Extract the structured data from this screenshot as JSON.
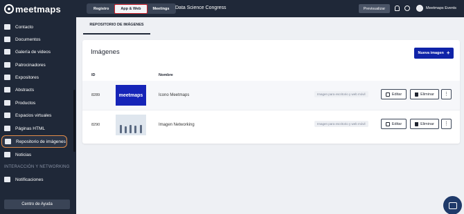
{
  "app": {
    "logo": "meetmaps"
  },
  "sidebar": {
    "items": [
      {
        "label": "Contacto",
        "icon": "contact-icon"
      },
      {
        "label": "Documentos",
        "icon": "document-icon"
      },
      {
        "label": "Galería de videos",
        "icon": "video-icon"
      },
      {
        "label": "Patrocinadores",
        "icon": "sponsors-icon"
      },
      {
        "label": "Expositores",
        "icon": "exhibitors-icon"
      },
      {
        "label": "Abstracts",
        "icon": "abstracts-icon"
      },
      {
        "label": "Productos",
        "icon": "products-icon"
      },
      {
        "label": "Espacios virtuales",
        "icon": "virtual-spaces-icon"
      },
      {
        "label": "Páginas HTML",
        "icon": "html-pages-icon"
      },
      {
        "label": "Repositorio de imágenes",
        "icon": "image-repository-icon",
        "active": true
      },
      {
        "label": "Noticias",
        "icon": "news-icon"
      }
    ],
    "section_title": "INTERACCIÓN Y NETWORKING",
    "section_items": [
      {
        "label": "Notificaciones",
        "icon": "bell-icon"
      }
    ],
    "help_button": "Centro de Ayuda"
  },
  "topbar": {
    "tabs": [
      {
        "label": "Registro"
      },
      {
        "label": "App & Web",
        "selected": true
      },
      {
        "label": "Meetings"
      }
    ],
    "event_title": "Data Science Congress",
    "preview_button": "Previsualizar",
    "account_name": "Meetmaps Events"
  },
  "main": {
    "tab": "REPOSITORIO DE IMÁGENES",
    "title": "Imágenes",
    "new_button": "Nueva imagen",
    "columns": {
      "id": "ID",
      "name": "Nombre"
    },
    "rows": [
      {
        "id": "8289",
        "thumb_text": "meetmaps",
        "name": "Icono Meetmaps",
        "usage": "Imagen para escritorio y web móvil",
        "edit": "Editar",
        "delete": "Eliminar"
      },
      {
        "id": "8290",
        "thumb_text": "",
        "name": "Imagen Networking",
        "usage": "Imagen para escritorio y web móvil",
        "edit": "Editar",
        "delete": "Eliminar"
      }
    ]
  },
  "colors": {
    "sidebar_bg": "#1f2838",
    "accent": "#0f23a8",
    "active_outline": "#e38d4a",
    "selected_tab_outline": "#d3212b"
  }
}
